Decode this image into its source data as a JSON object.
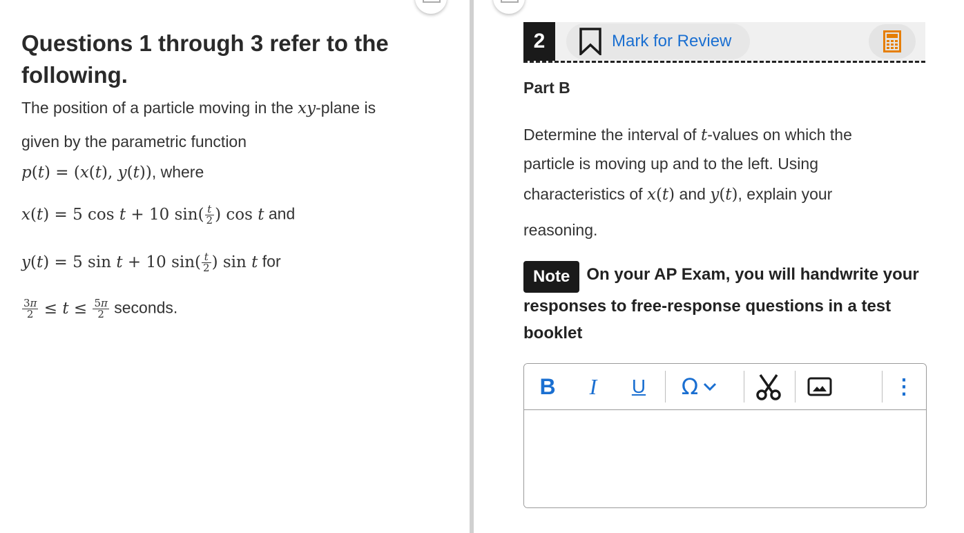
{
  "stimulus": {
    "heading": "Questions 1 through 3 refer to the following.",
    "line1_text": "The position of a particle moving in the ",
    "line1_var": "xy",
    "line1_tail": "-plane is",
    "line2": "given by the parametric function",
    "line3_tail": ", where",
    "line4_tail": " and",
    "line5_tail": " for",
    "line6_tail": " seconds."
  },
  "question": {
    "number": "2",
    "mark_for_review": "Mark for Review",
    "part": "Part B",
    "prompt_1a": "Determine the interval of ",
    "prompt_1var": "t",
    "prompt_1b": "-values on which the",
    "prompt_2": "particle is moving up and to the left. Using",
    "prompt_3a": "characteristics of ",
    "prompt_3b": " and ",
    "prompt_3c": ", explain your",
    "prompt_4": "reasoning."
  },
  "note": {
    "badge": "Note",
    "text": "On your AP Exam, you will handwrite your responses to free-response questions in a test booklet"
  },
  "editor": {
    "bold": "B",
    "italic": "I",
    "underline": "U",
    "omega": "Ω",
    "more": "⋮",
    "value": ""
  },
  "colors": {
    "accent_blue": "#1a6fd1",
    "calculator_orange": "#e67e00",
    "header_dark": "#1a1a1a"
  },
  "icons": [
    "bookmark-icon",
    "calculator-icon",
    "special-characters-icon",
    "chevron-down-icon",
    "cut-icon",
    "image-icon",
    "more-options-icon",
    "expand-icon"
  ]
}
